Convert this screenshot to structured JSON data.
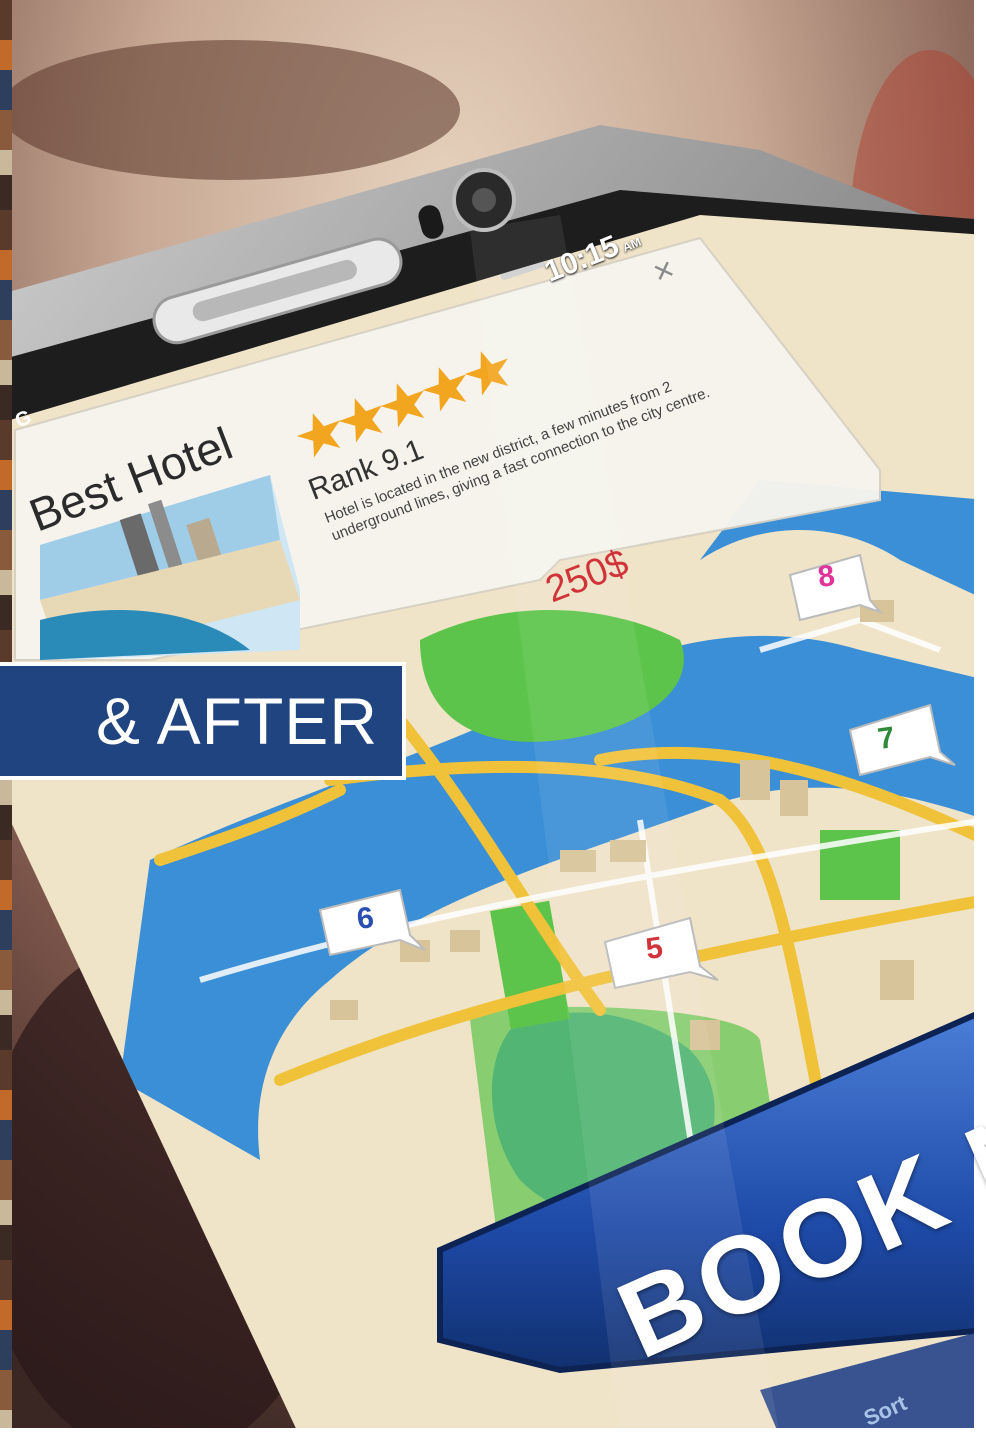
{
  "banner": {
    "text": "& AFTER"
  },
  "phone": {
    "status": {
      "time": "10:15",
      "ampm": "AM",
      "carrier": "G"
    },
    "popup": {
      "title": "Best Hotel",
      "rank": "Rank 9.1",
      "stars": 5,
      "description": "Hotel is located in the new district, a few minutes from 2 underground lines, giving a fast connection to the city centre.",
      "price": "250$",
      "close_glyph": "×"
    },
    "map_pins": [
      {
        "label": "8",
        "color": "#e0349a"
      },
      {
        "label": "7",
        "color": "#2f8a3a"
      },
      {
        "label": "6",
        "color": "#2a4fb0"
      },
      {
        "label": "5",
        "color": "#d0343a"
      }
    ],
    "book_button": {
      "label": "BOOK N"
    },
    "tab_label": "Sort"
  },
  "colors": {
    "banner_bg": "#1f4480",
    "price": "#d0343a",
    "book_button": "#1e4aa8",
    "water": "#3a8fd6",
    "park": "#5cc44a",
    "road": "#f0c23a",
    "land": "#efe3c8"
  },
  "icons": [
    "close-icon",
    "star-icon",
    "battery-icon",
    "speaker-grille",
    "front-camera-icon",
    "map-pin-icon"
  ]
}
